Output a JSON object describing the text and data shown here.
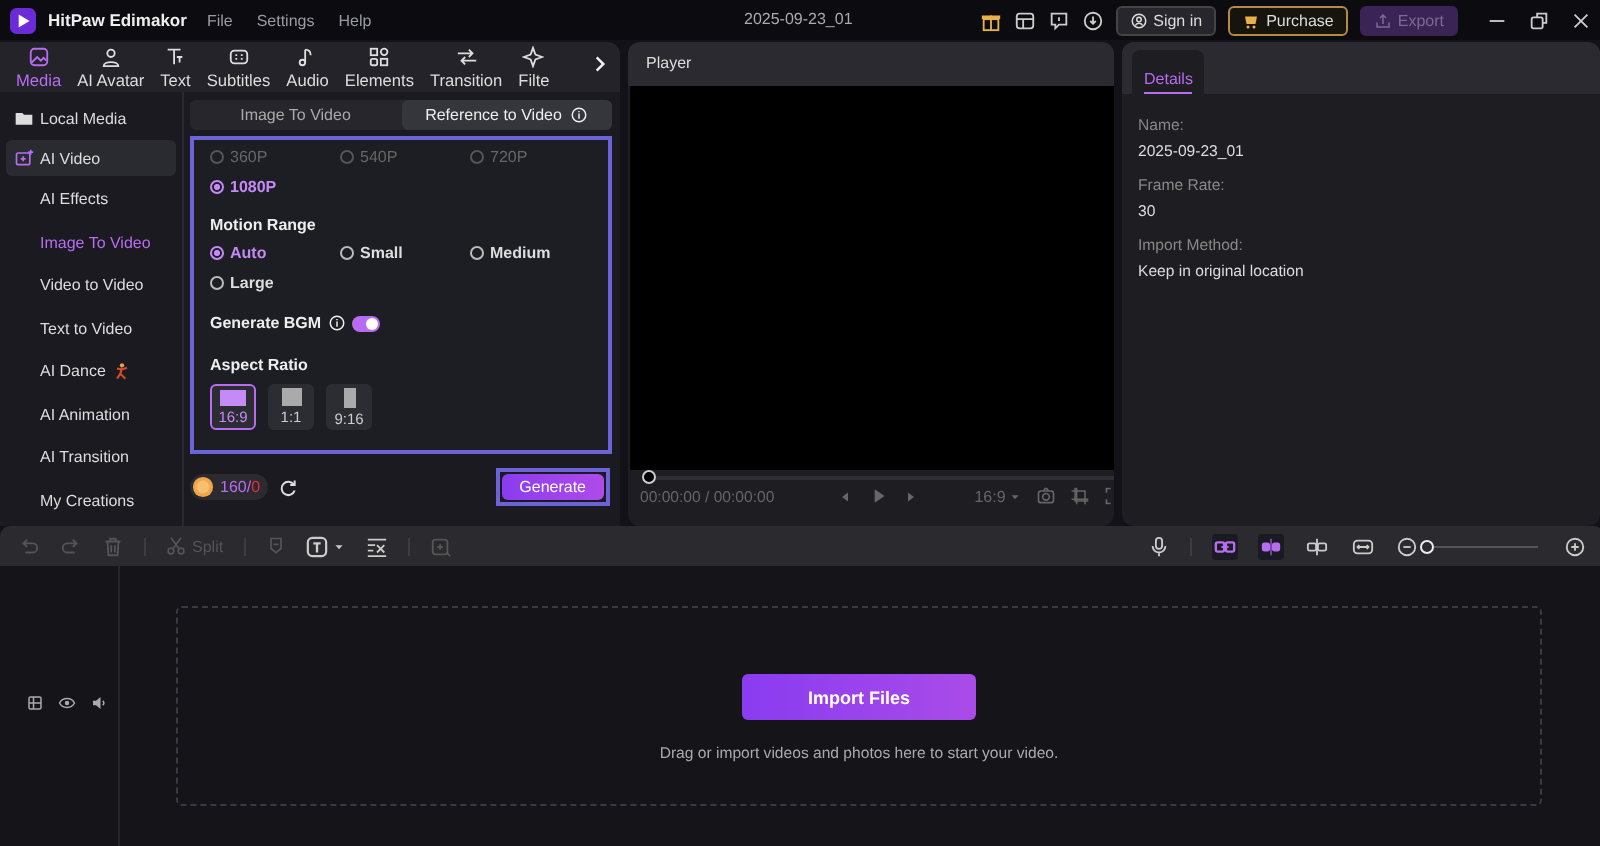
{
  "app": {
    "name": "HitPaw Edimakor"
  },
  "menu": [
    "File",
    "Settings",
    "Help"
  ],
  "project_title": "2025-09-23_01",
  "account_buttons": [
    {
      "label": "Sign in",
      "kind": "signin",
      "disabled": false
    },
    {
      "label": "Purchase",
      "kind": "purchase",
      "disabled": false
    },
    {
      "label": "Export",
      "kind": "export",
      "disabled": true
    }
  ],
  "tool_tabs": [
    {
      "label": "Media",
      "kind": "media",
      "selected": true
    },
    {
      "label": "AI Avatar",
      "kind": "avatar",
      "selected": false
    },
    {
      "label": "Text",
      "kind": "text",
      "selected": false
    },
    {
      "label": "Subtitles",
      "kind": "subtitles",
      "selected": false
    },
    {
      "label": "Audio",
      "kind": "audio",
      "selected": false
    },
    {
      "label": "Elements",
      "kind": "elements",
      "selected": false
    },
    {
      "label": "Transition",
      "kind": "transition",
      "selected": false
    },
    {
      "label": "Filte",
      "kind": "filter",
      "selected": false
    }
  ],
  "sidebar": {
    "items": [
      {
        "label": "Local Media",
        "kind": "folder",
        "expanded": false
      },
      {
        "label": "AI Video",
        "kind": "ai",
        "expanded": true,
        "children": [
          {
            "label": "AI Effects",
            "selected": false
          },
          {
            "label": "Image To Video",
            "selected": true
          },
          {
            "label": "Video to Video",
            "selected": false
          },
          {
            "label": "Text to Video",
            "selected": false
          },
          {
            "label": "AI Dance",
            "selected": false,
            "kind": "dance"
          },
          {
            "label": "AI Animation",
            "selected": false
          },
          {
            "label": "AI Transition",
            "selected": false
          },
          {
            "label": "My Creations",
            "selected": false
          }
        ]
      }
    ]
  },
  "generator": {
    "tabs": [
      {
        "label": "Image To Video",
        "selected": false,
        "info": false
      },
      {
        "label": "Reference to Video",
        "selected": true,
        "info": true
      }
    ],
    "resolutions": [
      {
        "label": "360P",
        "selected": false,
        "disabled": true
      },
      {
        "label": "540P",
        "selected": false,
        "disabled": true
      },
      {
        "label": "720P",
        "selected": false,
        "disabled": true
      },
      {
        "label": "1080P",
        "selected": true,
        "disabled": false
      }
    ],
    "motion_range": {
      "label": "Motion Range",
      "options": [
        {
          "label": "Auto",
          "selected": true
        },
        {
          "label": "Small",
          "selected": false
        },
        {
          "label": "Medium",
          "selected": false
        },
        {
          "label": "Large",
          "selected": false
        }
      ]
    },
    "bgm": {
      "label": "Generate BGM",
      "info": true,
      "on": true
    },
    "aspect_ratio": {
      "label": "Aspect Ratio",
      "options": [
        {
          "label": "16:9",
          "kind": "wide",
          "selected": true
        },
        {
          "label": "1:1",
          "kind": "square",
          "selected": false
        },
        {
          "label": "9:16",
          "kind": "tall",
          "selected": false
        }
      ]
    },
    "credits": {
      "balance": "160/",
      "cost": "0"
    },
    "generate_button": "Generate"
  },
  "player": {
    "title": "Player",
    "level": 0,
    "time": "00:00:00 / 00:00:00",
    "aspect": "16:9"
  },
  "details": {
    "tab": "Details",
    "fields": [
      {
        "label": "Name:",
        "value": "2025-09-23_01"
      },
      {
        "label": "Frame Rate:",
        "value": "30"
      },
      {
        "label": "Import Method:",
        "value": "Keep in original location"
      }
    ]
  },
  "timeline": {
    "split": "Split",
    "toggles": [
      {
        "kind": "link",
        "on": true
      },
      {
        "kind": "snap",
        "on": true
      },
      {
        "kind": "clip",
        "on": false
      },
      {
        "kind": "fit",
        "on": false
      }
    ],
    "zoom": {
      "level": 0
    },
    "import_button": "Import Files",
    "hint": "Drag or import videos and photos here to start your video."
  }
}
